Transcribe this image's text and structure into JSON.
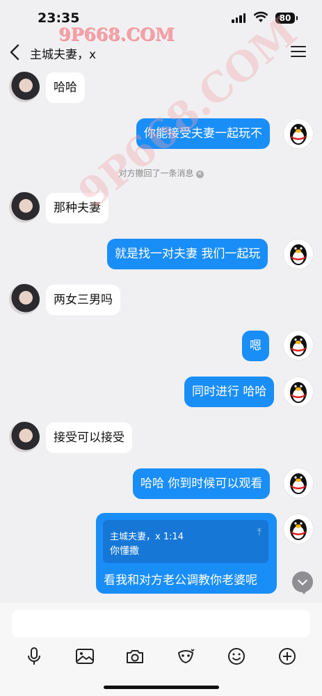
{
  "status": {
    "time": "23:35",
    "battery": "80"
  },
  "watermark": "9P668.COM",
  "watermark_diag": "9P668.COM",
  "nav": {
    "title": "主城夫妻，x"
  },
  "messages": [
    {
      "from": "partner",
      "text": "哈哈"
    },
    {
      "from": "me",
      "text": "你能接受夫妻一起玩不"
    },
    {
      "from": "partner",
      "text": "那种夫妻"
    },
    {
      "from": "me",
      "text": "就是找一对夫妻 我们一起玩"
    },
    {
      "from": "partner",
      "text": "两女三男吗"
    },
    {
      "from": "me",
      "text": "嗯"
    },
    {
      "from": "me",
      "text": "同时进行 哈哈"
    },
    {
      "from": "partner",
      "text": "接受可以接受"
    },
    {
      "from": "me",
      "text": "哈哈 你到时候可以观看"
    }
  ],
  "system_notice": "对方撤回了一条消息",
  "quote": {
    "meta": "主城夫妻，x 1:14",
    "text": "你懂撒",
    "reply": "看我和对方老公调教你老婆呢"
  },
  "composer": {
    "placeholder": ""
  },
  "icons": [
    "microphone-icon",
    "image-icon",
    "camera-icon",
    "red-packet-icon",
    "emoji-icon",
    "plus-icon"
  ]
}
